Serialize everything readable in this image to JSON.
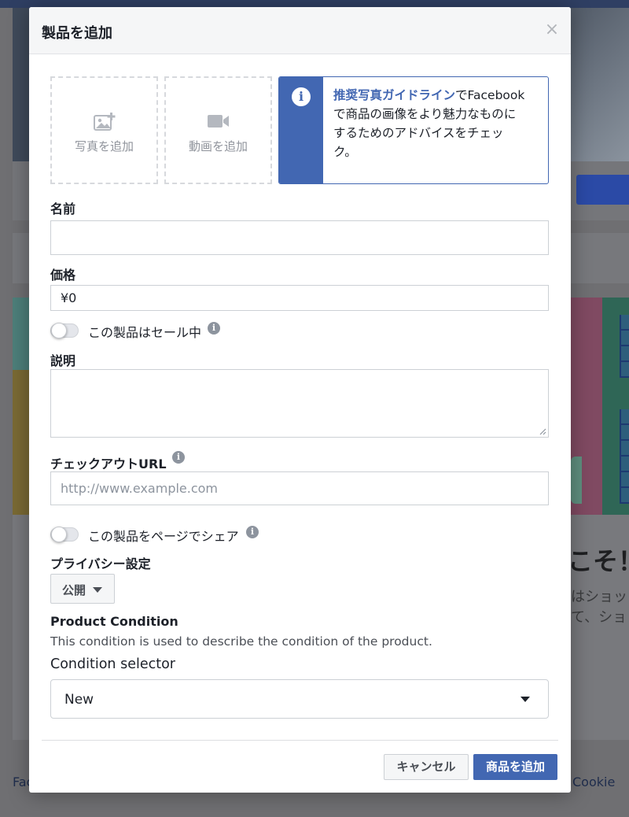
{
  "modal": {
    "title": "製品を追加",
    "close_glyph": "×"
  },
  "media": {
    "photo_label": "写真を追加",
    "video_label": "動画を追加",
    "info_glyph": "i",
    "info_link": "推奨写真ガイドライン",
    "info_text_1": "でFacebook",
    "info_text_2": "で商品の画像をより魅力なものに",
    "info_text_3": "するためのアドバイスをチェッ",
    "info_text_4": "ク。"
  },
  "fields": {
    "name_label": "名前",
    "name_value": "",
    "price_label": "価格",
    "price_value": "¥0",
    "sale_toggle_label": "この製品はセール中",
    "description_label": "説明",
    "description_value": "",
    "checkout_label": "チェックアウトURL",
    "checkout_placeholder": "http://www.example.com",
    "share_toggle_label": "この製品をページでシェア",
    "help_glyph": "i"
  },
  "toggles": {
    "sale_on": false,
    "share_on": false
  },
  "privacy": {
    "label": "プライバシー設定",
    "selected": "公開"
  },
  "product_condition": {
    "title": "Product Condition",
    "description": "This condition is used to describe the condition of the product.",
    "selector_label": "Condition selector",
    "selected": "New"
  },
  "footer": {
    "cancel_label": "キャンセル",
    "add_label": "商品を追加"
  },
  "background": {
    "big_text": "こそ！",
    "sub_text_1": "はショッ",
    "sub_text_2": "て、ショ",
    "footer_left": "Fac",
    "footer_right": "Cookie"
  },
  "colors": {
    "accent": "#4267b2",
    "text": "#1d2129",
    "muted": "#90949c",
    "border": "#ccd0d5"
  }
}
